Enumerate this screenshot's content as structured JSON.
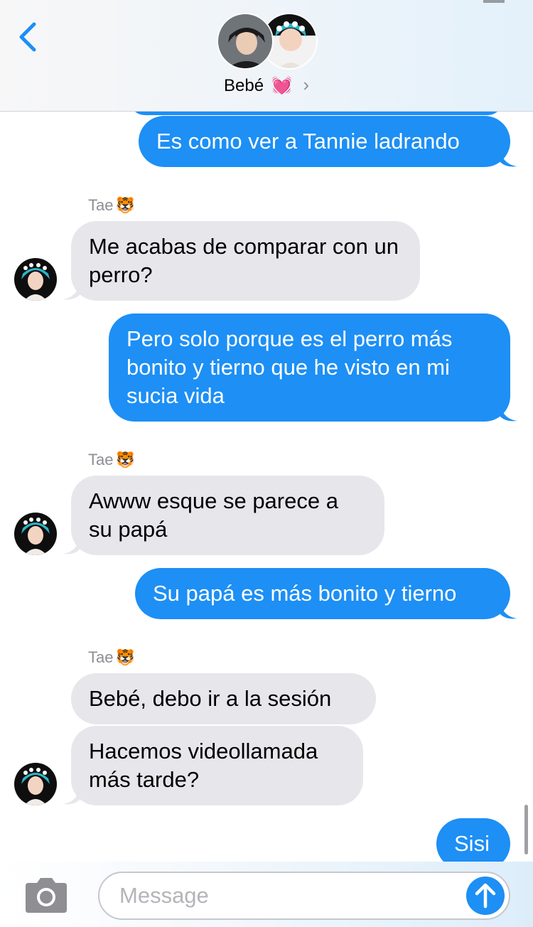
{
  "header": {
    "contact_name": "Bebé",
    "heart_emoji": "💓",
    "chevron": "›"
  },
  "messages": [
    {
      "side": "out",
      "text": "Es como ver a Tannie ladrando"
    },
    {
      "side": "in",
      "sender": "Tae",
      "text": "Me acabas de comparar con un perro?"
    },
    {
      "side": "out",
      "text": "Pero solo porque es el perro más bonito y tierno que he visto en mi sucia vida"
    },
    {
      "side": "in",
      "sender": "Tae",
      "text": "Awww esque se parece a su papá"
    },
    {
      "side": "out",
      "text": "Su papá es más bonito y tierno"
    },
    {
      "side": "in",
      "sender": "Tae",
      "text": "Bebé, debo ir a la sesión"
    },
    {
      "side": "in",
      "sender": "Tae",
      "text": "Hacemos videollamada más tarde?"
    },
    {
      "side": "out",
      "text": "Sisi"
    }
  ],
  "sender_emoji": "🐯",
  "input": {
    "placeholder": "Message"
  },
  "icons": {
    "back": "chevron-left-icon",
    "camera": "camera-icon",
    "send": "arrow-up-icon"
  },
  "colors": {
    "outgoing_bubble": "#1d8ff5",
    "incoming_bubble": "#e6e6eb",
    "accent": "#1d8ff5"
  }
}
